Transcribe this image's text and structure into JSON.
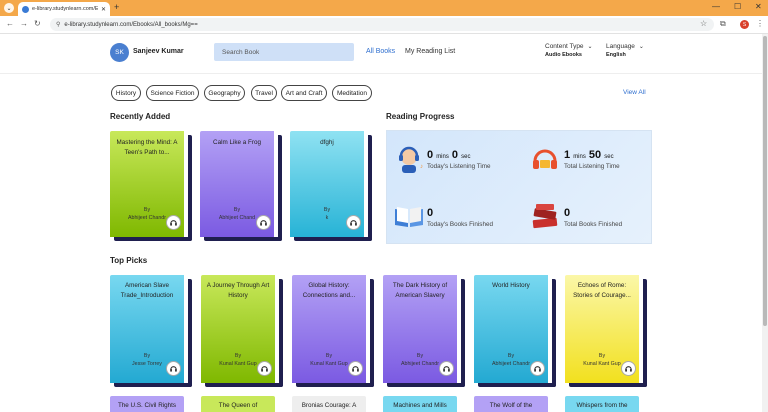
{
  "browser": {
    "tab_title": "e-library.studynlearn.com/Eb...",
    "url": "e-library.studynlearn.com/Ebooks/All_books/Mg==",
    "profile_initial": "S"
  },
  "header": {
    "avatar_initials": "SK",
    "user_name": "Sanjeev Kumar",
    "search_placeholder": "Search Book",
    "nav_all_books": "All Books",
    "nav_reading_list": "My Reading List",
    "content_type_label": "Content Type",
    "content_type_value": "Audio Ebooks",
    "language_label": "Language",
    "language_value": "English"
  },
  "categories": [
    "History",
    "Science Fiction",
    "Geography",
    "Travel",
    "Art and Craft",
    "Meditation"
  ],
  "view_all": "View All",
  "recently_added": {
    "title": "Recently Added",
    "books": [
      {
        "title": "Mastering the Mind: A Teen's Path to...",
        "by": "By",
        "author": "Abhijeet Chandr",
        "color_top": "#c8e85a",
        "color_bottom": "#7fb800"
      },
      {
        "title": "Calm Like a Frog",
        "by": "By",
        "author": "Abhijeet Chand",
        "color_top": "#b3a1f5",
        "color_bottom": "#7b5ae2"
      },
      {
        "title": "dfghj",
        "by": "By",
        "author": "k",
        "color_top": "#8fe2f2",
        "color_bottom": "#27b3d6"
      }
    ]
  },
  "reading_progress": {
    "title": "Reading Progress",
    "today_listening": {
      "mins": "0",
      "mins_unit": "mins",
      "secs": "0",
      "secs_unit": "sec",
      "label": "Today's Listening Time"
    },
    "total_listening": {
      "mins": "1",
      "mins_unit": "mins",
      "secs": "50",
      "secs_unit": "sec",
      "label": "Total Listening Time"
    },
    "today_books": {
      "value": "0",
      "label": "Today's Books Finished"
    },
    "total_books": {
      "value": "0",
      "label": "Total Books Finished"
    }
  },
  "top_picks": {
    "title": "Top Picks",
    "books": [
      {
        "title": "American Slave Trade_Introduction",
        "by": "By",
        "author": "Jesse Torrey",
        "color_top": "#78d8f0",
        "color_bottom": "#23a9d2"
      },
      {
        "title": "A Journey Through Art History",
        "by": "By",
        "author": "Kunal Kant Gup",
        "color_top": "#c8e85a",
        "color_bottom": "#7fb800"
      },
      {
        "title": "Global History: Connections and...",
        "by": "By",
        "author": "Kunal Kant Gup",
        "color_top": "#b3a1f5",
        "color_bottom": "#7b5ae2"
      },
      {
        "title": "The Dark History of American Slavery",
        "by": "By",
        "author": "Abhijeet Chandr",
        "color_top": "#b3a1f5",
        "color_bottom": "#7b5ae2"
      },
      {
        "title": "World History",
        "by": "By",
        "author": "Abhijeet Chandr",
        "color_top": "#78d8f0",
        "color_bottom": "#23a9d2"
      },
      {
        "title": "Echoes of Rome: Stories of Courage...",
        "by": "By",
        "author": "Kunal Kant Gup",
        "color_top": "#fbf7a8",
        "color_bottom": "#f2e01e"
      }
    ]
  },
  "third_row": [
    {
      "title": "The U.S. Civil Rights",
      "color": "#b3a1f5"
    },
    {
      "title": "The Queen of",
      "color": "#c8e85a"
    },
    {
      "title": "Bronias Courage: A",
      "color": "#eeeeee"
    },
    {
      "title": "Machines and Mills",
      "color": "#78d8f0"
    },
    {
      "title": "The Wolf of the",
      "color": "#b3a1f5"
    },
    {
      "title": "Whispers from the",
      "color": "#78d8f0"
    }
  ]
}
